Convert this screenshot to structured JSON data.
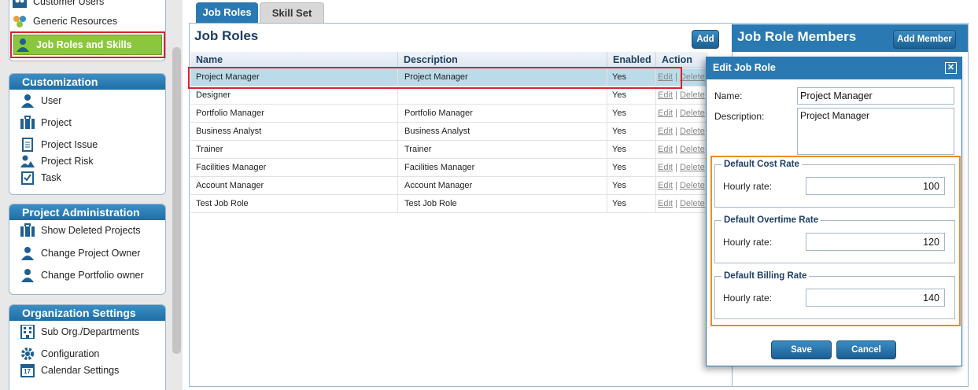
{
  "sidebar": {
    "top_items": [
      {
        "label": "Customer Users",
        "icon": "users-icon"
      },
      {
        "label": "Generic Resources",
        "icon": "resources-icon"
      },
      {
        "label": "Job Roles and Skills",
        "icon": "job-role-icon",
        "active": true
      }
    ],
    "sections": [
      {
        "title": "Customization",
        "items": [
          {
            "label": "User",
            "icon": "user-icon"
          },
          {
            "label": "Project",
            "icon": "briefcase-icon"
          },
          {
            "label": "Project Issue",
            "icon": "document-icon"
          },
          {
            "label": "Project Risk",
            "icon": "risk-icon"
          },
          {
            "label": "Task",
            "icon": "checkbox-icon"
          }
        ]
      },
      {
        "title": "Project Administration",
        "items": [
          {
            "label": "Show Deleted Projects",
            "icon": "briefcase-icon"
          },
          {
            "label": "Change Project Owner",
            "icon": "user-icon"
          },
          {
            "label": "Change Portfolio owner",
            "icon": "user-icon"
          }
        ]
      },
      {
        "title": "Organization Settings",
        "items": [
          {
            "label": "Sub Org./Departments",
            "icon": "building-icon"
          },
          {
            "label": "Configuration",
            "icon": "gear-icon"
          },
          {
            "label": "Calendar Settings",
            "icon": "calendar-icon"
          }
        ]
      }
    ],
    "calendar_day": "17"
  },
  "tabs": [
    {
      "label": "Job Roles",
      "active": true
    },
    {
      "label": "Skill Set",
      "active": false
    }
  ],
  "job_roles": {
    "title": "Job Roles",
    "add_label": "Add",
    "columns": [
      "Name",
      "Description",
      "Enabled",
      "Action"
    ],
    "rows": [
      {
        "name": "Project Manager",
        "description": "Project Manager",
        "enabled": "Yes",
        "selected": true
      },
      {
        "name": "Designer",
        "description": "",
        "enabled": "Yes"
      },
      {
        "name": "Portfolio Manager",
        "description": "Portfolio Manager",
        "enabled": "Yes"
      },
      {
        "name": "Business Analyst",
        "description": "Business Analyst",
        "enabled": "Yes"
      },
      {
        "name": "Trainer",
        "description": "Trainer",
        "enabled": "Yes"
      },
      {
        "name": "Facilities Manager",
        "description": "Facilities Manager",
        "enabled": "Yes"
      },
      {
        "name": "Account Manager",
        "description": "Account Manager",
        "enabled": "Yes"
      },
      {
        "name": "Test Job Role",
        "description": "Test Job Role",
        "enabled": "Yes"
      }
    ],
    "action_edit": "Edit",
    "action_sep": "|",
    "action_delete": "Delete"
  },
  "members": {
    "title": "Job Role Members",
    "add_member_label": "Add Member"
  },
  "dialog": {
    "title": "Edit Job Role",
    "close_glyph": "✕",
    "name_label": "Name:",
    "name_value": "Project Manager",
    "description_label": "Description:",
    "description_value": "Project Manager",
    "rates": [
      {
        "legend": "Default Cost Rate",
        "label": "Hourly rate:",
        "value": "100"
      },
      {
        "legend": "Default Overtime Rate",
        "label": "Hourly rate:",
        "value": "120"
      },
      {
        "legend": "Default Billing Rate",
        "label": "Hourly rate:",
        "value": "140"
      }
    ],
    "save_label": "Save",
    "cancel_label": "Cancel"
  },
  "colors": {
    "accent": "#2b79b2",
    "active_nav": "#8cc63f",
    "highlight_red": "#d9232e",
    "highlight_orange": "#f08a24",
    "selected_row": "#b9dce8"
  }
}
